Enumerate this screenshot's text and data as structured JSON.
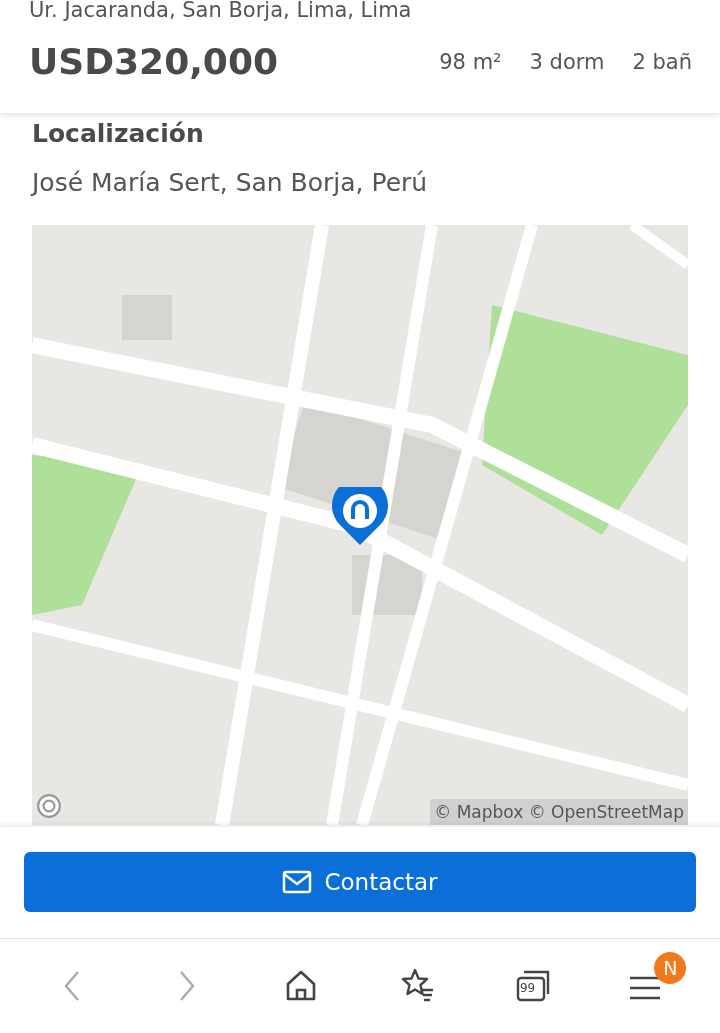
{
  "header": {
    "address": "Ur. Jacaranda, San Borja, Lima, Lima",
    "price": "USD320,000",
    "features": [
      "98 m²",
      "3 dorm",
      "2 bañ"
    ]
  },
  "location": {
    "title": "Localización",
    "address": "José María Sert, San Borja, Perú",
    "map": {
      "kind": "picture",
      "attribution": "© Mapbox © OpenStreetMap"
    }
  },
  "contact_button": {
    "label": "Contactar"
  },
  "browser_bar": [
    {
      "kind": "back",
      "disabled": true
    },
    {
      "kind": "forward",
      "disabled": true
    },
    {
      "kind": "home",
      "disabled": false
    },
    {
      "kind": "bookmarks",
      "disabled": false
    },
    {
      "kind": "tabs",
      "disabled": false,
      "count": "99"
    },
    {
      "kind": "menu",
      "disabled": false,
      "badge": "N"
    }
  ]
}
